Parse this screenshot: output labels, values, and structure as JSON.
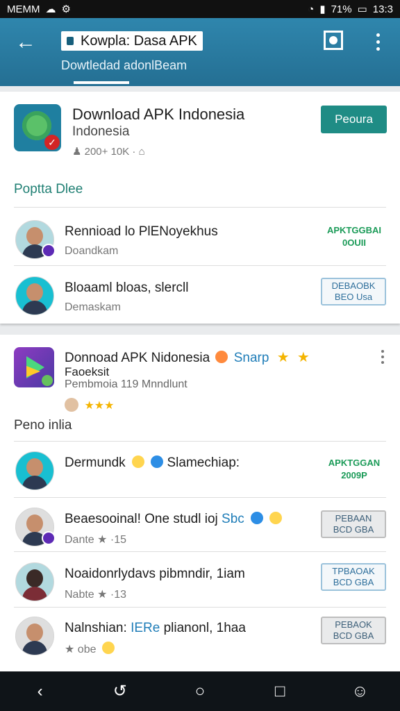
{
  "statusbar": {
    "left": "MEMM",
    "icons_left": [
      "cloud-icon",
      "settings-icon"
    ],
    "battery": "71%",
    "time": "13:3"
  },
  "appbar": {
    "title": "Kowpla: Dasa APK",
    "subtitle": "Dowtledad adonlBeam"
  },
  "card1": {
    "app": {
      "title": "Download APK Indonesia",
      "subtitle": "Indonesia",
      "meta": "200+ 10K ·"
    },
    "primary_button": "Peoura",
    "section": "Poptta Dlee",
    "rows": [
      {
        "title": "Rennioad lo PlENoyekhus",
        "subtitle": "Doandkam",
        "action": "APKTGGBAI 0OUII"
      },
      {
        "title": "Bloaaml bloas, slercll",
        "subtitle": "Demaskam",
        "action": "DEBAOBK BEO Usa"
      }
    ]
  },
  "card2": {
    "app": {
      "title": "Donnoad APK Nidonesia",
      "blue": "Snarp",
      "line2": "Faoeksit",
      "line3": "Pembmoia 119 Mnndlunt",
      "rating": "★★★"
    },
    "section": "Peno inlia",
    "rows": [
      {
        "title": "Dermundk",
        "subtitle": "Slamechiap:",
        "action": "APKTGGAN 2009P"
      },
      {
        "title": "Beaesooinal! One studl ioj",
        "blue": "Sbc",
        "subtitle": "Dante ★ ·15",
        "action": "PEBAAN BCD GBA"
      },
      {
        "title": "Noaidonrlydavs pibmndir, 1iam",
        "subtitle": "Nabte ★ ·13",
        "action": "TPBAOAK BCD GBA"
      },
      {
        "title": "Nalnshian:",
        "blue": "IERe",
        "title_end": "plianonl, 1haa",
        "subtitle": "★ obe",
        "action": "PEBAOK BCD GBA"
      }
    ]
  },
  "navbar": {
    "items": [
      "back-icon",
      "history-icon",
      "home-icon",
      "recents-icon",
      "settings-icon"
    ]
  }
}
